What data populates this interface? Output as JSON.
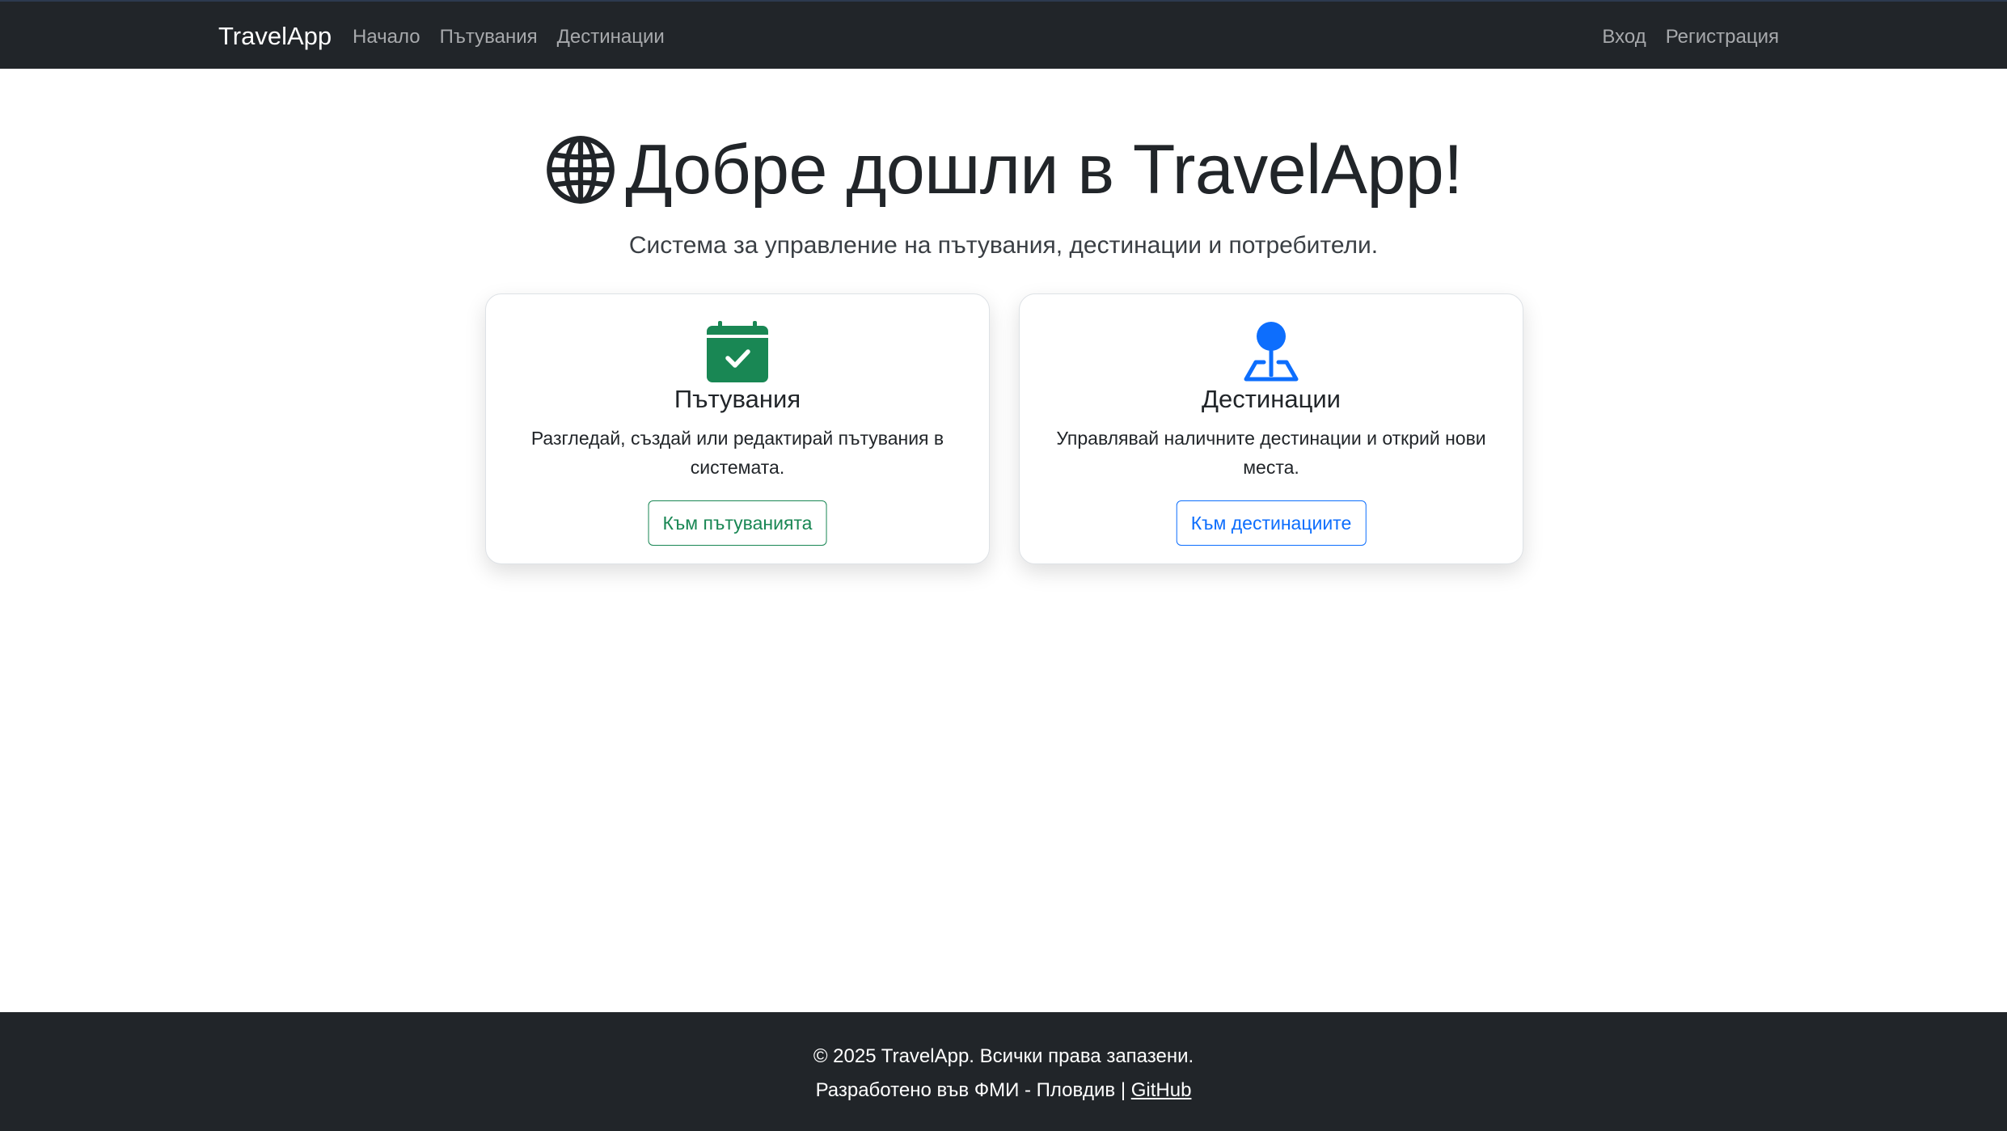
{
  "navbar": {
    "brand": "TravelApp",
    "left_links": [
      "Начало",
      "Пътувания",
      "Дестинации"
    ],
    "right_links": [
      "Вход",
      "Регистрация"
    ]
  },
  "hero": {
    "icon": "globe-icon",
    "title": "Добре дошли в TravelApp!",
    "subtitle": "Система за управление на пътувания, дестинации и потребители."
  },
  "cards": [
    {
      "icon": "calendar-check-icon",
      "title": "Пътувания",
      "text": "Разгледай, създай или редактирай пътувания в системата.",
      "button": "Към пътуванията",
      "color": "#198754"
    },
    {
      "icon": "map-pin-icon",
      "title": "Дестинации",
      "text": "Управлявай наличните дестинации и открий нови места.",
      "button": "Към дестинациите",
      "color": "#0d6efd"
    }
  ],
  "footer": {
    "copyright": "© 2025 TravelApp. Всички права запазени.",
    "developed": "Разработено във ФМИ - Пловдив | ",
    "github": "GitHub"
  },
  "colors": {
    "dark": "#212529",
    "green": "#198754",
    "blue": "#0d6efd"
  }
}
